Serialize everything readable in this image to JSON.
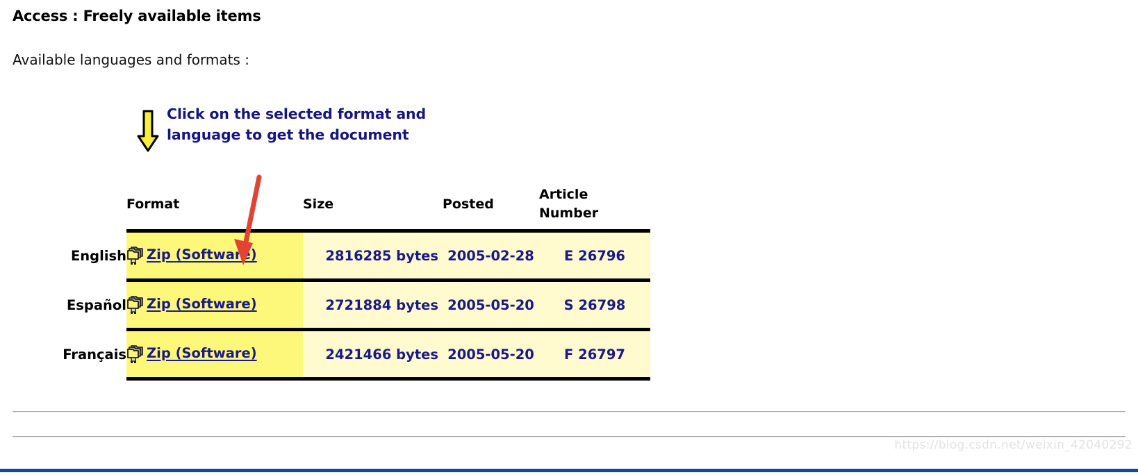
{
  "page": {
    "title": "Access : Freely available items",
    "subtitle": "Available languages and formats :"
  },
  "annotation": {
    "arrow_down_icon": "arrow-down-icon",
    "callout_text": "Click on the selected format and language to get the document",
    "callout_color": "#151583",
    "pointer_arrow_icon": "red-arrow-icon",
    "pointer_arrow_color": "#e04030"
  },
  "table": {
    "columns": [
      "",
      "Format",
      "Size",
      "Posted",
      "Article Number"
    ],
    "headers": {
      "language": "",
      "format": "Format",
      "size": "Size",
      "posted": "Posted",
      "article_number_line1": "Article",
      "article_number_line2": "Number"
    },
    "colors": {
      "format_cell_bg": "#fdf87a",
      "data_cell_bg": "#fffbcf",
      "link_text": "#1a1a86",
      "rule": "#000000"
    },
    "rows": [
      {
        "language": "English",
        "format": "Zip (Software)",
        "format_icon": "zip-folder-icon",
        "size": "2816285 bytes",
        "posted": "2005-02-28",
        "article_number": "E 26796"
      },
      {
        "language": "Español",
        "format": "Zip (Software)",
        "format_icon": "zip-folder-icon",
        "size": "2721884 bytes",
        "posted": "2005-05-20",
        "article_number": "S 26798"
      },
      {
        "language": "Français",
        "format": "Zip (Software)",
        "format_icon": "zip-folder-icon",
        "size": "2421466 bytes",
        "posted": "2005-05-20",
        "article_number": "F 26797"
      }
    ]
  },
  "footer": {
    "watermark": "https://blog.csdn.net/weixin_42040292",
    "bar_color": "#1d4786"
  }
}
